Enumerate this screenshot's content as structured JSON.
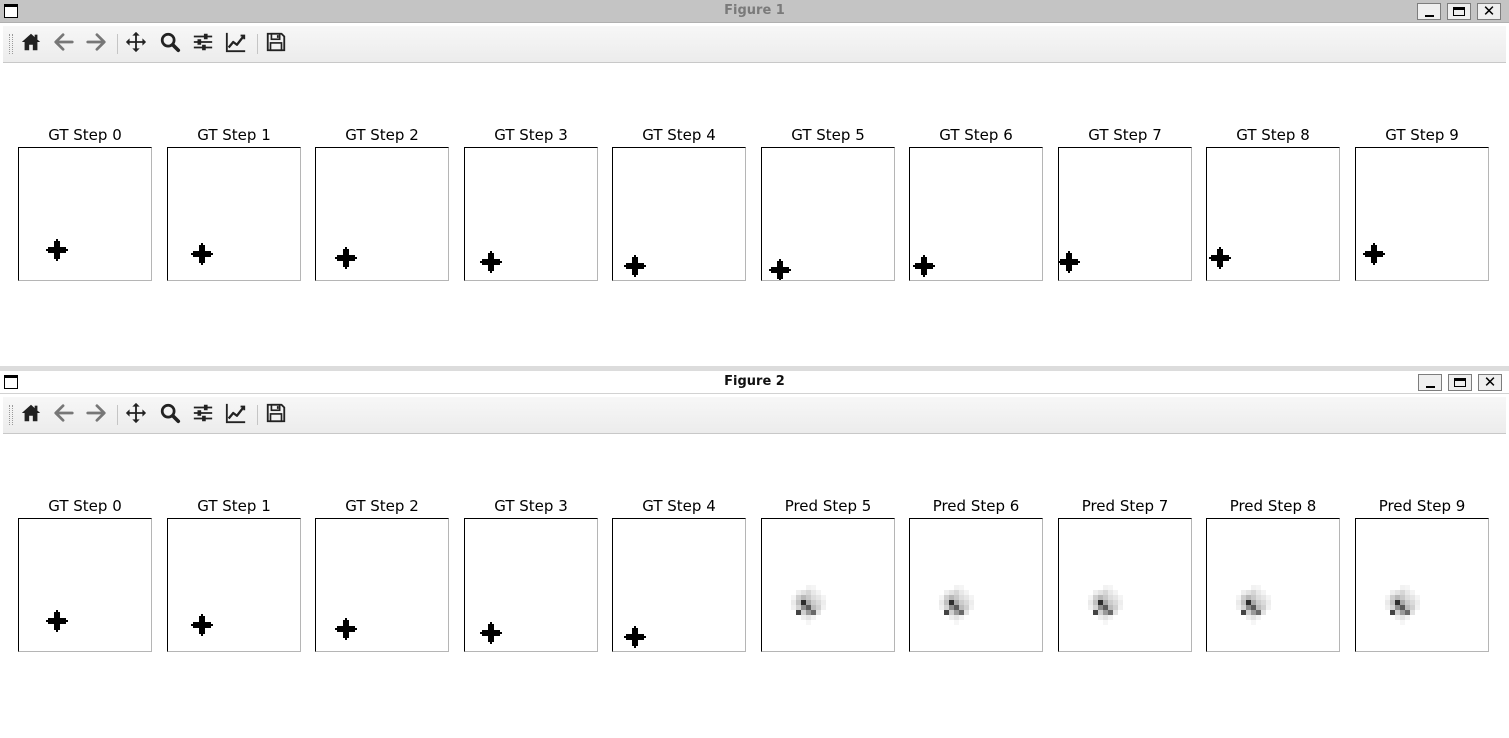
{
  "windows": [
    {
      "title": "Figure 1",
      "panels": [
        {
          "title": "GT Step 0",
          "kind": "gt"
        },
        {
          "title": "GT Step 1",
          "kind": "gt"
        },
        {
          "title": "GT Step 2",
          "kind": "gt"
        },
        {
          "title": "GT Step 3",
          "kind": "gt"
        },
        {
          "title": "GT Step 4",
          "kind": "gt"
        },
        {
          "title": "GT Step 5",
          "kind": "gt"
        },
        {
          "title": "GT Step 6",
          "kind": "gt"
        },
        {
          "title": "GT Step 7",
          "kind": "gt"
        },
        {
          "title": "GT Step 8",
          "kind": "gt"
        },
        {
          "title": "GT Step 9",
          "kind": "gt"
        }
      ]
    },
    {
      "title": "Figure 2",
      "panels": [
        {
          "title": "GT Step 0",
          "kind": "gt"
        },
        {
          "title": "GT Step 1",
          "kind": "gt"
        },
        {
          "title": "GT Step 2",
          "kind": "gt"
        },
        {
          "title": "GT Step 3",
          "kind": "gt"
        },
        {
          "title": "GT Step 4",
          "kind": "gt"
        },
        {
          "title": "Pred Step 5",
          "kind": "pred"
        },
        {
          "title": "Pred Step 6",
          "kind": "pred"
        },
        {
          "title": "Pred Step 7",
          "kind": "pred"
        },
        {
          "title": "Pred Step 8",
          "kind": "pred"
        },
        {
          "title": "Pred Step 9",
          "kind": "pred"
        }
      ]
    }
  ],
  "toolbar_icons": [
    "home-icon",
    "back-arrow-icon",
    "forward-arrow-icon",
    "pan-icon",
    "zoom-icon",
    "configure-subplots-icon",
    "edit-axis-icon",
    "save-icon"
  ],
  "colors": {
    "titlebar_inactive": "#c4c4c4",
    "titlebar_active": "#ffffff",
    "marker": "#000000"
  }
}
